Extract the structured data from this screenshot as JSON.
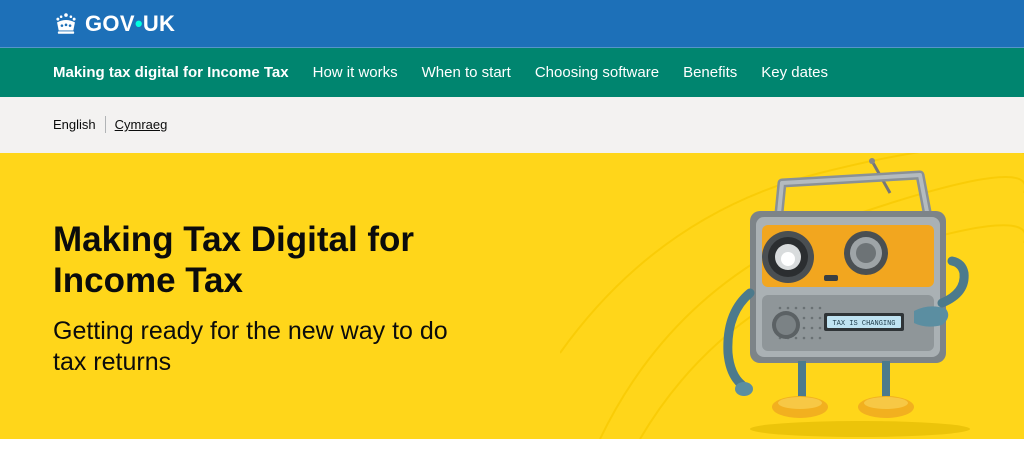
{
  "header": {
    "logo_text_left": "GOV",
    "logo_dot": "•",
    "logo_text_right": "UK"
  },
  "service_nav": {
    "service_name": "Making tax digital for Income Tax",
    "items": [
      {
        "label": "How it works"
      },
      {
        "label": "When to start"
      },
      {
        "label": "Choosing software"
      },
      {
        "label": "Benefits"
      },
      {
        "label": "Key dates"
      }
    ]
  },
  "language": {
    "current": "English",
    "alternate": "Cymraeg"
  },
  "hero": {
    "title": "Making Tax Digital for Income Tax",
    "subtitle": "Getting ready for the new way to do tax returns",
    "robot_display_text": "TAX IS CHANGING"
  },
  "colors": {
    "header_blue": "#1d70b8",
    "service_green": "#00856f",
    "lang_bar_grey": "#f3f2f1",
    "hero_yellow": "#ffd61a",
    "robot_orange": "#f2a61f"
  }
}
